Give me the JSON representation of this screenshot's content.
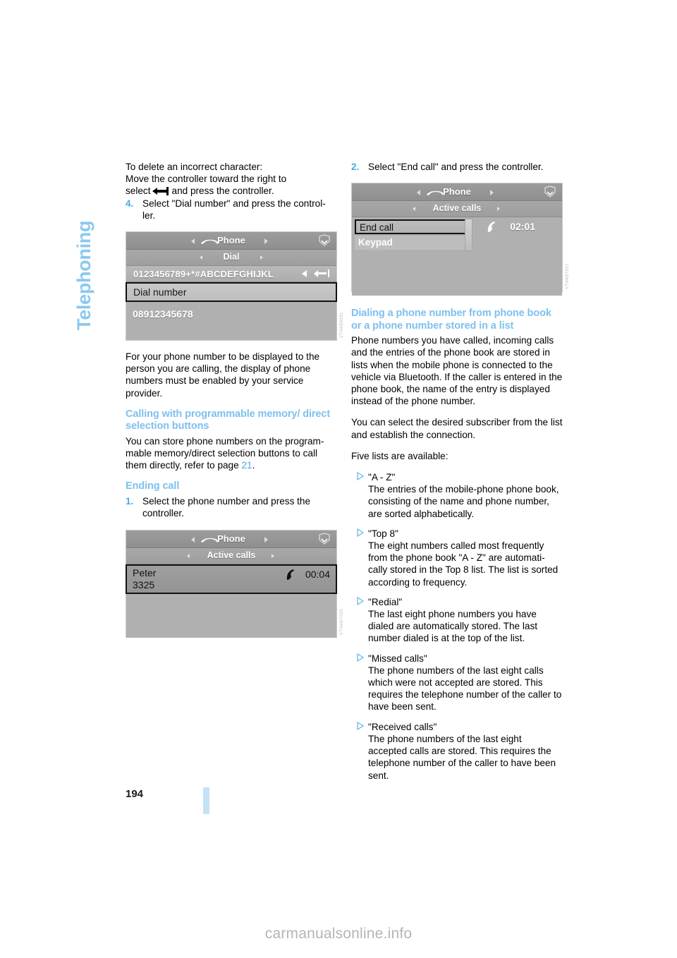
{
  "chapter": {
    "label": "Telephoning"
  },
  "page": {
    "number": "194"
  },
  "watermark": {
    "text": "carmanualsonline.info"
  },
  "left_column": {
    "intro": {
      "line1": "To delete an incorrect character:",
      "line2": "Move the controller toward the right to",
      "line3_before": "select",
      "line3_after": "and press the controller."
    },
    "step4": {
      "number": "4.",
      "text": "Select \"Dial number\" and press the control-ler."
    },
    "screenshot_dial": {
      "header_title": "Phone",
      "sub_title": "Dial",
      "char_strip": "0123456789+*#ABCDEFGHIJKL",
      "selected_row": "Dial number",
      "list_number": "08912345678",
      "code": "VTH4B9031"
    },
    "para_caller_id": "For your phone number to be displayed to the person you are calling, the display of phone numbers must be enabled by your service provider.",
    "heading_programmable": "Calling with programmable memory/ direct selection buttons",
    "para_programmable_pre": "You can store phone numbers on the program-mable memory/direct selection buttons to call them directly, refer to page",
    "para_programmable_page": "21",
    "para_programmable_post": ".",
    "heading_ending_call": "Ending call",
    "step1": {
      "number": "1.",
      "text": "Select the phone number and press the controller."
    },
    "screenshot_active": {
      "header_title": "Phone",
      "sub_title": "Active calls",
      "caller_name": "Peter",
      "caller_number": "3325",
      "duration": "00:04",
      "code": "VTH4B7020"
    }
  },
  "right_column": {
    "step2": {
      "number": "2.",
      "text": "Select \"End call\" and press the controller."
    },
    "screenshot_endcall": {
      "header_title": "Phone",
      "sub_title": "Active calls",
      "menu_item_selected": "End call",
      "menu_item_second": "Keypad",
      "duration": "02:01",
      "code": "VTH4B7021"
    },
    "heading_dialing": "Dialing a phone number from phone book or a phone number stored in a list",
    "para_1": "Phone numbers you have called, incoming calls and the entries of the phone book are stored in lists when the mobile phone is connected to the vehicle via Bluetooth. If the caller is entered in the phone book, the name of the entry is displayed instead of the phone number.",
    "para_2": "You can select the desired subscriber from the list and establish the connection.",
    "para_3": "Five lists are available:",
    "lists": [
      {
        "term": "\"A - Z\"",
        "desc": "The entries of the mobile-phone phone book, consisting of the name and phone number, are sorted alphabetically."
      },
      {
        "term": "\"Top 8\"",
        "desc": "The eight numbers called most frequently from the phone book \"A - Z\" are automati-cally stored in the Top 8 list. The list is sorted according to frequency."
      },
      {
        "term": "\"Redial\"",
        "desc": "The last eight phone numbers you have dialed are automatically stored. The last number dialed is at the top of the list."
      },
      {
        "term": "\"Missed calls\"",
        "desc": "The phone numbers of the last eight calls which were not accepted are stored. This requires the telephone number of the caller to have been sent."
      },
      {
        "term": "\"Received calls\"",
        "desc": "The phone numbers of the last eight accepted calls are stored. This requires the telephone number of the caller to have been sent."
      }
    ]
  },
  "colors": {
    "accent_blue": "#7ec0ee",
    "chapter_blue": "#8cc8f0",
    "footer_bar": "#c5e2f7"
  }
}
